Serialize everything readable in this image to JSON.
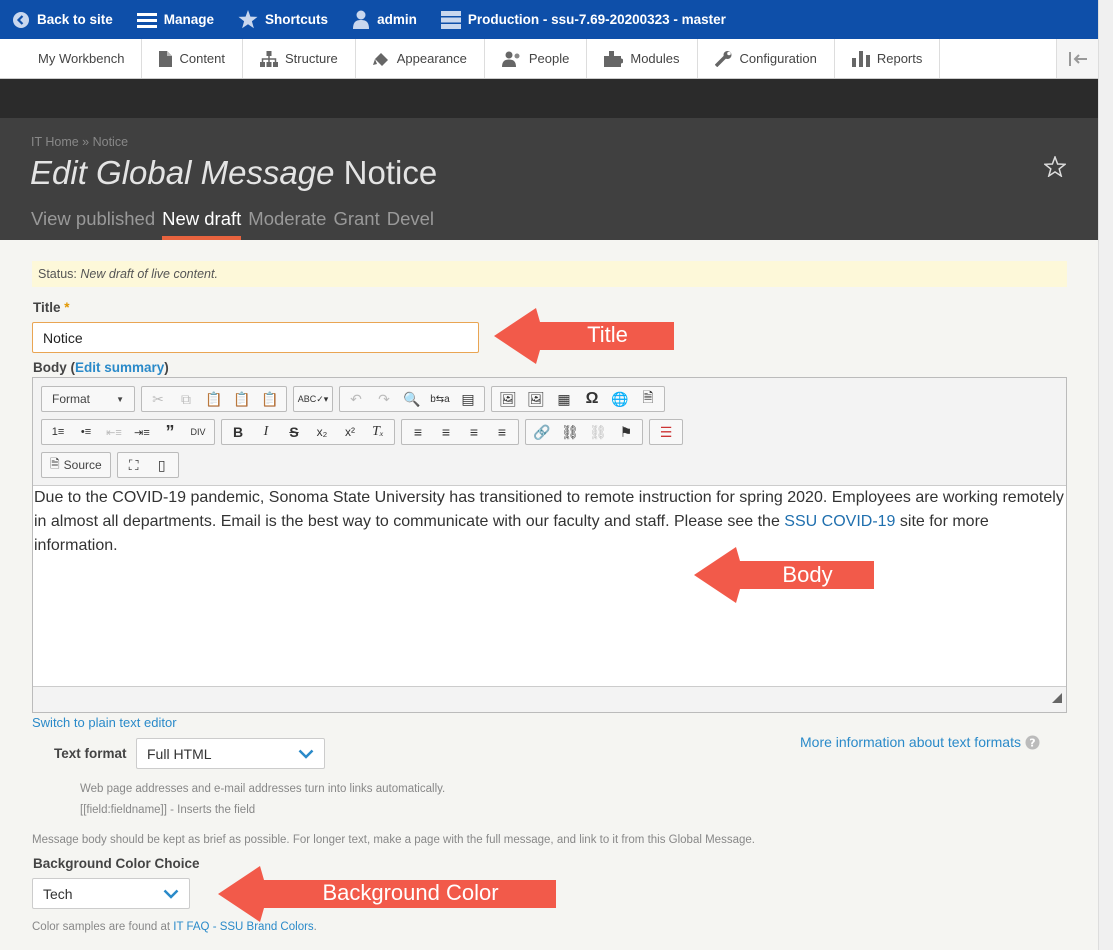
{
  "toolbar": {
    "back_label": "Back to site",
    "manage_label": "Manage",
    "shortcuts_label": "Shortcuts",
    "user_label": "admin",
    "env_label": "Production - ssu-7.69-20200323 - master"
  },
  "tray": {
    "items": [
      "My Workbench",
      "Content",
      "Structure",
      "Appearance",
      "People",
      "Modules",
      "Configuration",
      "Reports"
    ]
  },
  "header": {
    "breadcrumb": "IT Home » Notice",
    "title_italic": "Edit Global Message",
    "title_rest": " Notice",
    "tabs": [
      "View published",
      "New draft",
      "Moderate",
      "Grant",
      "Devel"
    ]
  },
  "status": {
    "label": "Status: ",
    "value": "New draft of live content."
  },
  "title_field": {
    "label": "Title",
    "required_mark": "*",
    "value": "Notice"
  },
  "body_field": {
    "label": "Body (",
    "edit_summary": "Edit summary",
    "label_end": ")",
    "format_label": "Format",
    "source_label": "Source",
    "text_before": "Due to the COVID-19 pandemic, Sonoma State University has transitioned to remote instruction for spring 2020. Employees are working remotely in almost all departments. Email is the best way to communicate with our faculty and staff. Please see the ",
    "link_text": "SSU COVID-19",
    "text_after": " site for more information."
  },
  "text_format": {
    "switch_link": "Switch to plain text editor",
    "label": "Text format",
    "value": "Full HTML",
    "more_info": "More information about text formats",
    "tip1": "Web page addresses and e-mail addresses turn into links automatically.",
    "tip2": "[[field:fieldname]] - Inserts the field",
    "help": "Message body should be kept as brief as possible. For longer text, make a page with the full message, and link to it from this Global Message."
  },
  "background": {
    "label": "Background Color Choice",
    "value": "Tech",
    "help_before": "Color samples are found at ",
    "help_link": "IT FAQ - SSU Brand Colors",
    "help_after": "."
  },
  "annotations": {
    "title": "Title",
    "body": "Body",
    "background": "Background Color"
  },
  "colors": {
    "toolbar": "#0e4fa9",
    "header": "#404040",
    "active_tab": "#e7633e",
    "annotation": "#f25a4a",
    "link": "#2a8ac9"
  }
}
